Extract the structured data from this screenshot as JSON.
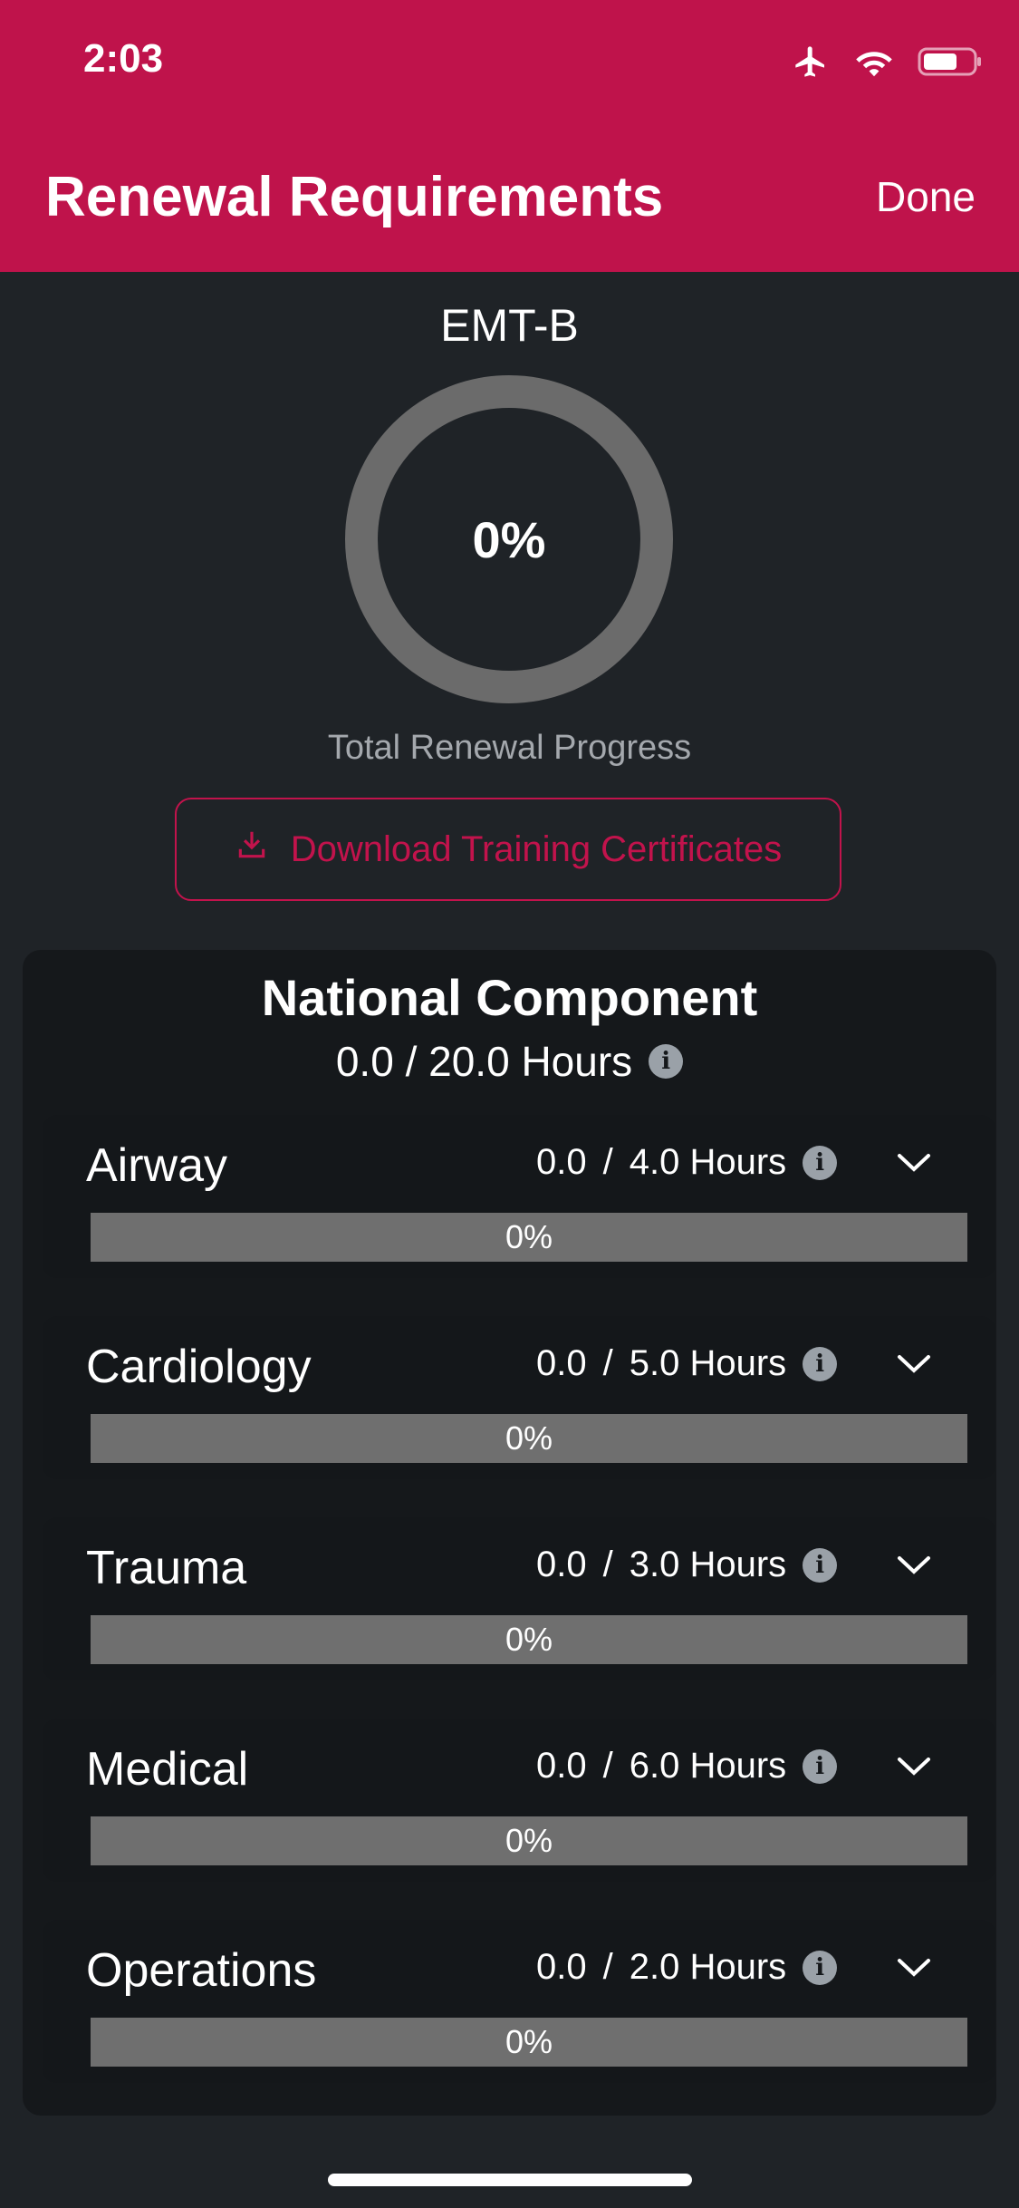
{
  "status_bar": {
    "time": "2:03",
    "icons": [
      "airplane-icon",
      "wifi-icon",
      "battery-icon"
    ]
  },
  "nav": {
    "title": "Renewal Requirements",
    "done_label": "Done"
  },
  "summary": {
    "cert_name": "EMT-B",
    "progress_label": "0%",
    "progress_value": 0,
    "caption": "Total Renewal Progress"
  },
  "download": {
    "label": "Download Training Certificates",
    "icon": "download-icon"
  },
  "national": {
    "title": "National Component",
    "hours": "0.0 / 20.0 Hours",
    "categories": [
      {
        "name": "Airway",
        "done": "0.0",
        "sep": "/",
        "total": "4.0 Hours",
        "percent_label": "0%",
        "progress": 0
      },
      {
        "name": "Cardiology",
        "done": "0.0",
        "sep": "/",
        "total": "5.0 Hours",
        "percent_label": "0%",
        "progress": 0
      },
      {
        "name": "Trauma",
        "done": "0.0",
        "sep": "/",
        "total": "3.0 Hours",
        "percent_label": "0%",
        "progress": 0
      },
      {
        "name": "Medical",
        "done": "0.0",
        "sep": "/",
        "total": "6.0 Hours",
        "percent_label": "0%",
        "progress": 0
      },
      {
        "name": "Operations",
        "done": "0.0",
        "sep": "/",
        "total": "2.0 Hours",
        "percent_label": "0%",
        "progress": 0
      }
    ]
  },
  "colors": {
    "brand": "#bf134b",
    "background": "#1f2327",
    "card": "#15181b",
    "bar": "#6f6f6f",
    "ring": "#6b6b6b"
  }
}
